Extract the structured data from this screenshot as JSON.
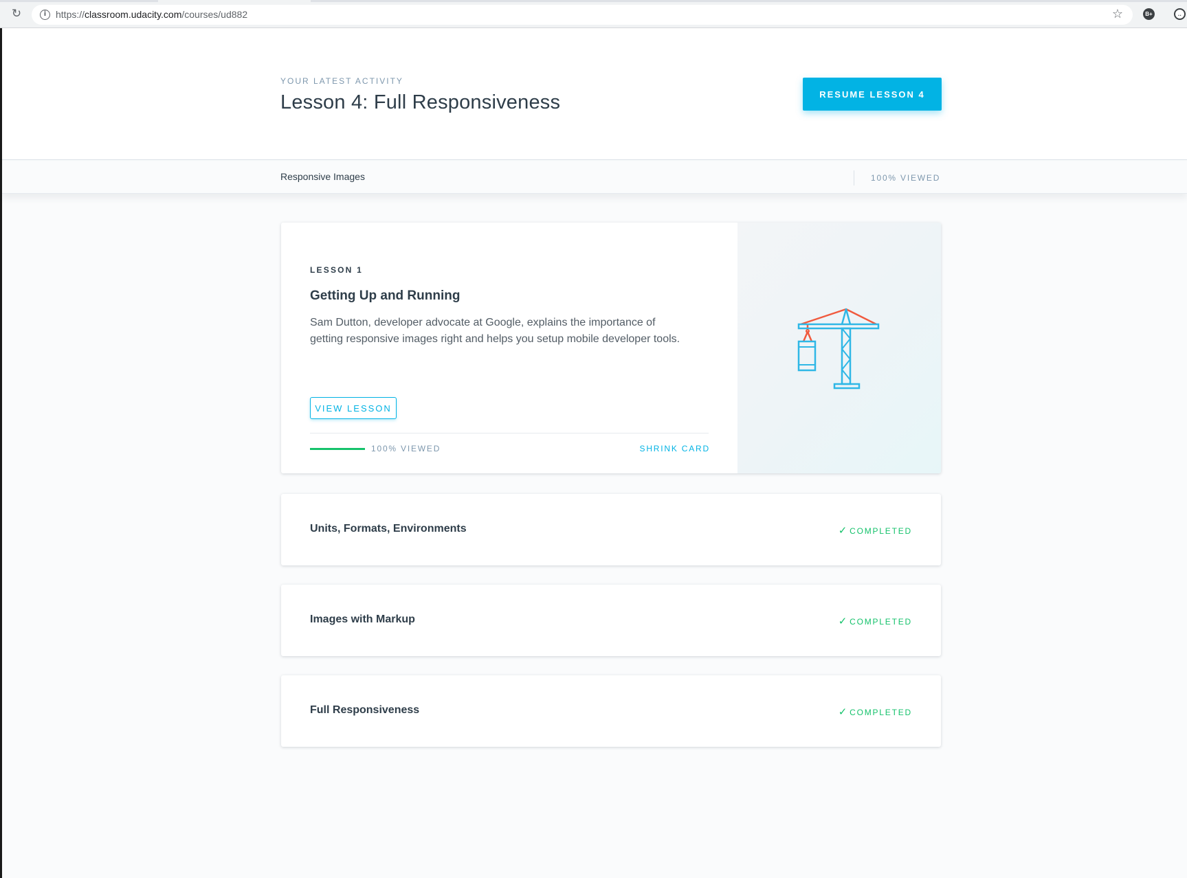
{
  "browser": {
    "url_scheme": "https://",
    "url_host": "classroom.udacity.com",
    "url_path": "/courses/ud882",
    "extension_b_label": "B+"
  },
  "header": {
    "eyebrow": "YOUR LATEST ACTIVITY",
    "title": "Lesson 4: Full Responsiveness",
    "resume_button": "RESUME LESSON 4"
  },
  "subbar": {
    "concept": "Responsive Images",
    "viewed": "100% VIEWED"
  },
  "lessons": [
    {
      "number": "LESSON 1",
      "title": "Getting Up and Running",
      "description": "Sam Dutton, developer advocate at Google, explains the importance of getting responsive images right and helps you setup mobile developer tools.",
      "view_button": "VIEW LESSON",
      "progress_label": "100% VIEWED",
      "progress": 1.0,
      "shrink_link": "SHRINK CARD",
      "art_icon": "crane-icon"
    },
    {
      "title": "Units, Formats, Environments",
      "status": "COMPLETED"
    },
    {
      "title": "Images with Markup",
      "status": "COMPLETED"
    },
    {
      "title": "Full Responsiveness",
      "status": "COMPLETED"
    }
  ],
  "colors": {
    "accent": "#02b3e4",
    "success": "#15c26b",
    "crane_blue": "#2fb7e6",
    "crane_red": "#f05a3e"
  }
}
